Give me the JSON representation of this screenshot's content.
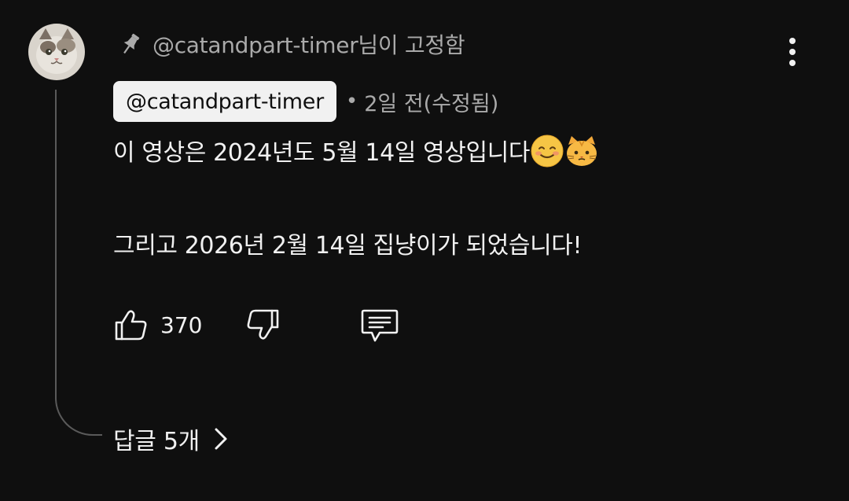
{
  "pin": {
    "text": "@catandpart-timer님이 고정함",
    "icon": "pin-icon"
  },
  "comment": {
    "author": "@catandpart-timer",
    "meta_dot": "•",
    "time": "2일 전(수정됨)",
    "line1": "이 영상은 2024년도 5월 14일 영상입니다",
    "line1_emojis": [
      "smiling-face-emoji",
      "cat-face-emoji"
    ],
    "line2": "그리고 2026년 2월 14일 집냥이가 되었습니다!"
  },
  "actions": {
    "like_count": "370",
    "like_icon": "thumbs-up-icon",
    "dislike_icon": "thumbs-down-icon",
    "reply_icon": "comment-icon"
  },
  "replies": {
    "label": "답글 5개",
    "icon": "chevron-right-icon"
  },
  "colors": {
    "background": "#0f0f0f",
    "primary_text": "#f1f1f1",
    "secondary_text": "#aaaaaa",
    "chip_background": "#f1f1f1",
    "thread_line": "#5a5a5a"
  }
}
